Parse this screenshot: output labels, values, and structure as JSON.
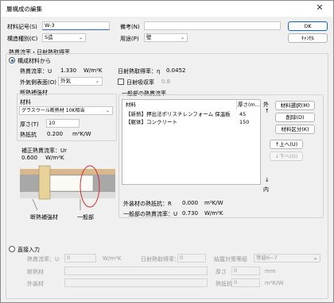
{
  "window": {
    "title": "層構成の編集"
  },
  "header": {
    "code_label": "材料記号(S)",
    "code_value": "W-3",
    "remark_label": "備考(N)",
    "remark_value": "",
    "type_label": "構造種別(C)",
    "type_value": "S造",
    "use_label": "用途(P)",
    "use_value": "壁",
    "ok_label": "OK",
    "cancel_label": "ｷｬﾝｾﾙ"
  },
  "section": {
    "title": "熱貫流率・日射熱取得率"
  },
  "composition": {
    "radio_label": "構成材料から",
    "u_label": "熱貫流率：U",
    "u_value": "1.330",
    "u_unit": "W/m²K",
    "eta_label": "日射熱取得率：η",
    "eta_value": "0.0452",
    "outer_label": "外気側表面(O)",
    "outer_value": "外気",
    "absorb_label": "日射吸収率",
    "absorb_value": "0.8"
  },
  "insulation": {
    "group_title": "断熱補強材",
    "material_label": "材料",
    "material_value": "グラスウール断熱材 10K相当",
    "thickness_label": "厚さ(T)",
    "thickness_value": "10",
    "resist_label": "熱抵抗",
    "resist_value": "0.200",
    "resist_unit": "m²K/W",
    "corrected_label": "補正熱貫流率：Ur",
    "corrected_value": "0.600",
    "corrected_unit": "W/m²K",
    "insulation_caption": "断熱補強材",
    "general_caption": "一般部"
  },
  "general": {
    "group_title": "一般部の熱貫流率",
    "col_material": "材料",
    "col_thickness": "厚さ(m...",
    "rows": [
      {
        "material": "【新熱】押出法ポリスチレンフォーム 保温板 ...",
        "thickness": "45"
      },
      {
        "material": "【躯体】コンクリート",
        "thickness": "150"
      }
    ],
    "outside_label": "外",
    "inside_label": "内",
    "up_arrow": "↑",
    "down_arrow": "↓",
    "select_btn": "材料選択(M)",
    "delete_btn": "削除(D)",
    "classify_btn": "材料区分(K)",
    "up_btn": "↑上へ(U)",
    "down_btn": "↓下へ(O)",
    "ext_r_label": "外装材の熱抵抗：R",
    "ext_r_value": "0.000",
    "ext_r_unit": "m²K/W",
    "u_label": "一般部の熱貫流率：U",
    "u_value": "0.730",
    "u_unit": "W/m²K"
  },
  "direct": {
    "radio_label": "直接入力",
    "u_label": "熱貫流率：U",
    "u_value": "0",
    "u_unit": "W/m²K",
    "eta_label": "日射熱取得率：η",
    "eta_value": "0",
    "grade_label": "結露対策等級",
    "grade_value": "等級6~7",
    "insulation_label": "断熱材",
    "thickness_label": "厚さ",
    "thickness_value": "0",
    "thickness_unit": "mm",
    "exterior_label": "外装材",
    "resist_label": "熱抵抗",
    "resist_value": "0",
    "resist_unit": "m²K/W"
  }
}
